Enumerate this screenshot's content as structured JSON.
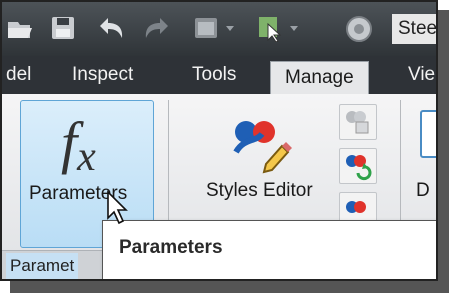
{
  "app": {
    "title_fragment": "Stee"
  },
  "quick_access": {
    "icons": [
      "open-file-icon",
      "save-icon",
      "undo-icon",
      "redo-icon",
      "appearance-icon",
      "select-icon",
      "material-icon"
    ]
  },
  "ribbon_tabs": [
    {
      "label": "del",
      "active": false
    },
    {
      "label": "Inspect",
      "active": false
    },
    {
      "label": "Tools",
      "active": false
    },
    {
      "label": "Manage",
      "active": true
    },
    {
      "label": "Vie",
      "active": false
    }
  ],
  "ribbon": {
    "parameters_button": {
      "label": "Parameters",
      "icon": "fx-icon"
    },
    "styles_editor_button": {
      "label": "Styles Editor"
    },
    "small_buttons": [
      "purge-styles-icon",
      "update-styles-icon",
      "style-library-icon"
    ],
    "document_button_label_fragment": "D",
    "panel_title_fragment": "Paramet"
  },
  "tooltip": {
    "text": "Parameters"
  },
  "colors": {
    "dark_toolbar": "#2f3438",
    "active_button_fill": "#b9ddf5",
    "active_button_border": "#5fa5d6",
    "ribbon_bg": "#e6e7e9"
  }
}
